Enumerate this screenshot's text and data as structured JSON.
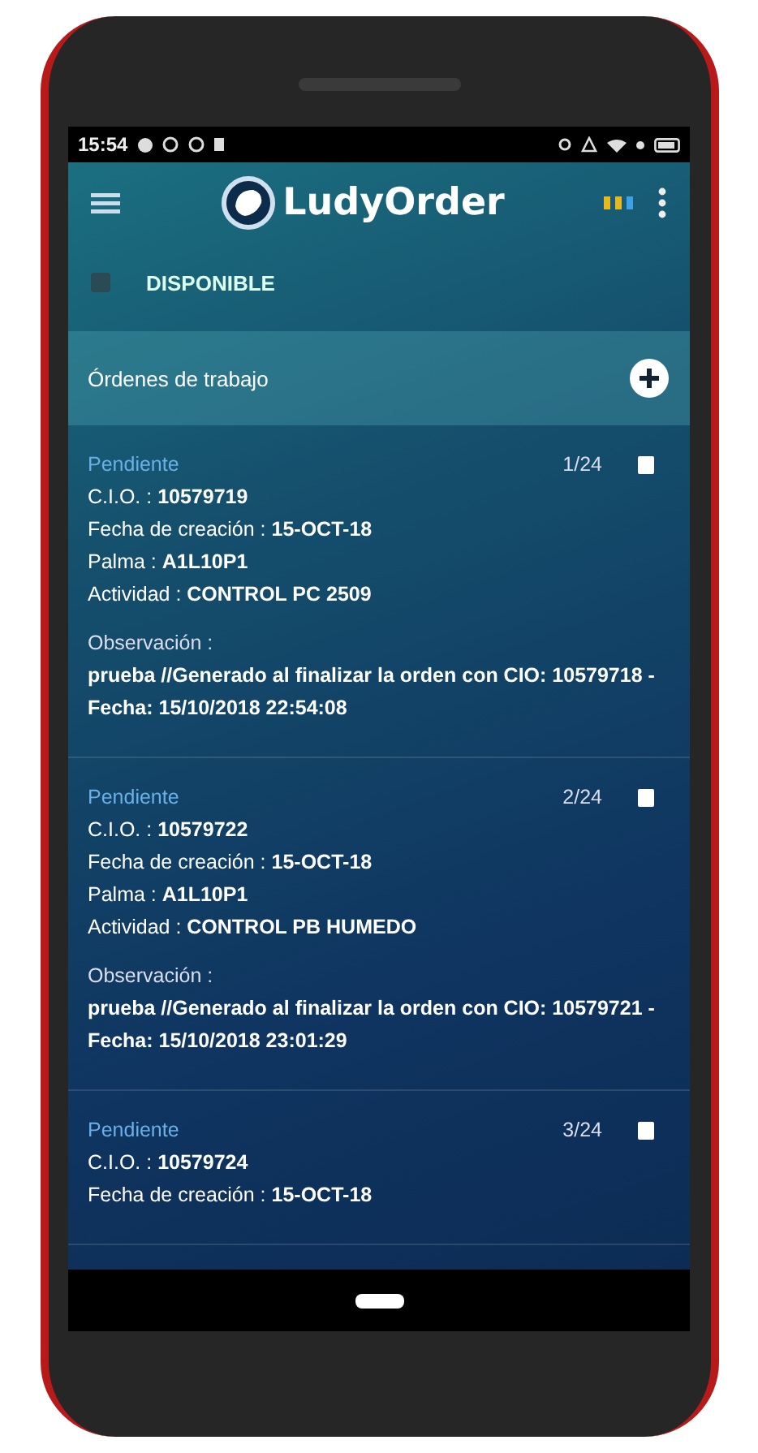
{
  "status_bar": {
    "time": "15:54"
  },
  "app_bar": {
    "title": "LudyOrder"
  },
  "availability": {
    "label": "DISPONIBLE",
    "checked": false
  },
  "section": {
    "title": "Órdenes de trabajo"
  },
  "orders": [
    {
      "status": "Pendiente",
      "count": "1/24",
      "checked": false,
      "fields": [
        {
          "label": "C.I.O. :",
          "value": "10579719"
        },
        {
          "label": "Fecha de creación :",
          "value": "15-OCT-18"
        },
        {
          "label": "Palma :",
          "value": "A1L10P1"
        },
        {
          "label": "Actividad :",
          "value": "CONTROL PC 2509"
        }
      ],
      "observation_label": "Observación :",
      "observation": "prueba //Generado al finalizar la orden con CIO: 10579718 - Fecha: 15/10/2018 22:54:08"
    },
    {
      "status": "Pendiente",
      "count": "2/24",
      "checked": false,
      "fields": [
        {
          "label": "C.I.O. :",
          "value": "10579722"
        },
        {
          "label": "Fecha de creación :",
          "value": "15-OCT-18"
        },
        {
          "label": "Palma :",
          "value": "A1L10P1"
        },
        {
          "label": "Actividad :",
          "value": "CONTROL PB HUMEDO"
        }
      ],
      "observation_label": "Observación :",
      "observation": "prueba //Generado al finalizar la orden con CIO: 10579721 - Fecha: 15/10/2018 23:01:29"
    },
    {
      "status": "Pendiente",
      "count": "3/24",
      "checked": false,
      "fields": [
        {
          "label": "C.I.O. :",
          "value": "10579724"
        },
        {
          "label": "Fecha de creación :",
          "value": "15-OCT-18"
        }
      ]
    }
  ]
}
